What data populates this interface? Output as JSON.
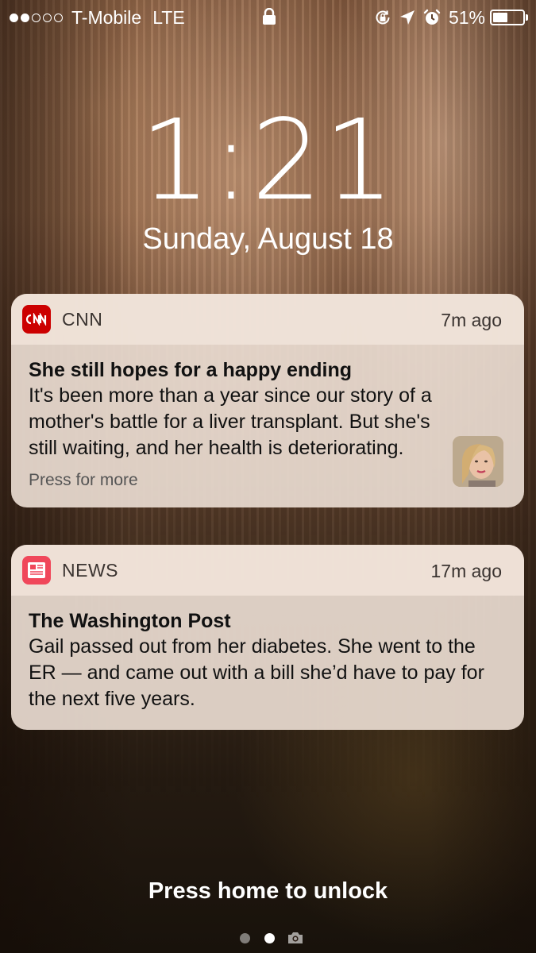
{
  "status_bar": {
    "signal_dots_filled": 2,
    "signal_dots_total": 5,
    "carrier": "T-Mobile",
    "network": "LTE",
    "battery_percent": "51%",
    "battery_level": 0.51,
    "icons": [
      "lock-icon",
      "orientation-lock-icon",
      "location-arrow-icon",
      "alarm-clock-icon",
      "battery-icon"
    ]
  },
  "lock_screen": {
    "time": "1:21",
    "date": "Sunday, August 18",
    "unlock_hint": "Press home to unlock"
  },
  "notifications": [
    {
      "app": "CNN",
      "app_icon": "cnn-logo-icon",
      "time_ago": "7m ago",
      "title": "She still hopes for a happy ending",
      "body": "It's been more than a year since our story of a mother's battle for a liver transplant. But she's still waiting, and her health is deteriorating.",
      "footer": "Press for more",
      "has_thumbnail": true
    },
    {
      "app": "NEWS",
      "app_icon": "news-app-icon",
      "time_ago": "17m ago",
      "title": "The Washington Post",
      "body": "Gail passed out from her diabetes. She went to the ER — and came out with a bill she’d have to pay for the next five years."
    }
  ],
  "page_indicator": {
    "pages": 2,
    "current": 2,
    "extra": "camera-icon"
  },
  "colors": {
    "cnn_red": "#cc0000",
    "news_red": "#f0475a",
    "notification_bg": "#e8dad0",
    "text_dark": "#111111"
  }
}
